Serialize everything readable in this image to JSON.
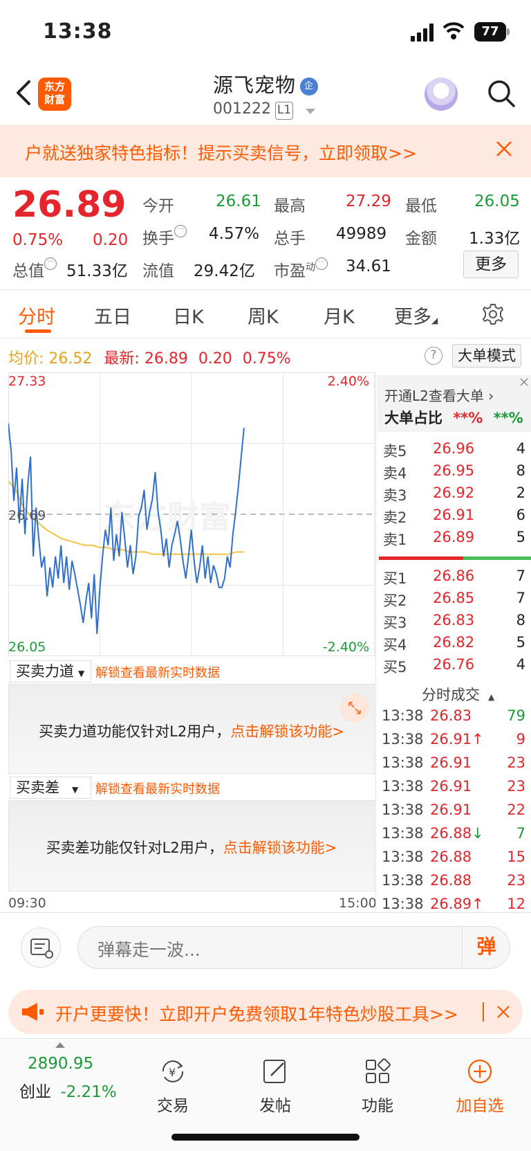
{
  "status": {
    "time": "13:38",
    "battery": "77"
  },
  "nav": {
    "logo_line1": "东方",
    "logo_line2": "财富",
    "title": "源飞宠物",
    "title_badge": "企",
    "code": "001222",
    "level": "L1"
  },
  "banner": {
    "text": "户就送独家特色指标！提示买卖信号，立即领取>>"
  },
  "quote": {
    "price": "26.89",
    "change_pct": "0.75%",
    "change": "0.20",
    "open_label": "今开",
    "open": "26.61",
    "high_label": "最高",
    "high": "27.29",
    "low_label": "最低",
    "low": "26.05",
    "turnover_label": "换手",
    "turnover": "4.57%",
    "volume_label": "总手",
    "volume": "49989",
    "amount_label": "金额",
    "amount": "1.33亿",
    "mktcap_label": "总值",
    "mktcap": "51.33亿",
    "float_label": "流值",
    "float": "29.42亿",
    "pe_label": "市盈",
    "pe_sup": "动",
    "pe": "34.61",
    "more": "更多"
  },
  "tabs": [
    "分时",
    "五日",
    "日K",
    "周K",
    "月K",
    "更多"
  ],
  "info": {
    "avg_label": "均价:",
    "avg": "26.52",
    "last_label": "最新:",
    "last": "26.89",
    "chg": "0.20",
    "pct": "0.75%",
    "mode": "大单模式"
  },
  "chart_data": {
    "type": "line",
    "y_left_top": "27.33",
    "y_left_mid": "26.69",
    "y_left_bottom": "26.05",
    "y_right_top": "2.40%",
    "y_right_bottom": "-2.40%",
    "x_start": "09:30",
    "x_end": "15:00",
    "watermark": "东方财富",
    "ylim": [
      26.05,
      27.33
    ],
    "prev_close": 26.69,
    "series": [
      {
        "values": [
          27.1,
          26.98,
          26.75,
          26.9,
          26.65,
          26.85,
          26.6,
          26.82,
          26.95,
          26.5,
          26.72,
          26.58,
          26.45,
          26.5,
          26.32,
          26.45,
          26.36,
          26.5,
          26.4,
          26.55,
          26.38,
          26.5,
          26.35,
          26.48,
          26.42,
          26.35,
          26.28,
          26.2,
          26.3,
          26.38,
          26.22,
          26.42,
          26.15,
          26.35,
          26.5,
          26.62,
          26.55,
          26.72,
          26.48,
          26.6,
          26.5,
          26.7,
          26.58,
          26.45,
          26.55,
          26.42,
          26.5,
          26.68,
          26.72,
          26.8,
          26.62,
          26.7,
          26.76,
          26.88,
          26.7,
          26.62,
          26.5,
          26.58,
          26.45,
          26.55,
          26.6,
          26.66,
          26.58,
          26.48,
          26.4,
          26.5,
          26.62,
          26.48,
          26.38,
          26.45,
          26.55,
          26.4,
          26.5,
          26.38,
          26.46,
          26.42,
          26.36,
          26.36,
          26.4,
          26.5,
          26.45,
          26.6,
          26.7,
          26.82,
          26.95,
          27.08
        ]
      },
      {
        "values": [
          26.84,
          26.8,
          26.72,
          26.68,
          26.65,
          26.62,
          26.6,
          26.58,
          26.57,
          26.56,
          26.55,
          26.55,
          26.54,
          26.54,
          26.53,
          26.53,
          26.52,
          26.52,
          26.52,
          26.51,
          26.51,
          26.51,
          26.51,
          26.51,
          26.51,
          26.51,
          26.51,
          26.51,
          26.51,
          26.51,
          26.52,
          26.52
        ]
      }
    ]
  },
  "ind1": {
    "name": "买卖力道",
    "note": "解锁查看最新实时数据",
    "msg": "买卖力道功能仅针对L2用户，",
    "link": "点击解锁该功能>"
  },
  "ind2": {
    "name": "买卖差",
    "note": "解锁查看最新实时数据",
    "msg": "买卖差功能仅针对L2用户，",
    "link": "点击解锁该功能>"
  },
  "l2": {
    "open_text": "开通L2查看大单",
    "ratio_label": "大单占比",
    "red_val": "**%",
    "green_val": "**%"
  },
  "asks": [
    {
      "label": "卖5",
      "price": "26.96",
      "vol": "4"
    },
    {
      "label": "卖4",
      "price": "26.95",
      "vol": "8"
    },
    {
      "label": "卖3",
      "price": "26.92",
      "vol": "2"
    },
    {
      "label": "卖2",
      "price": "26.91",
      "vol": "6"
    },
    {
      "label": "卖1",
      "price": "26.89",
      "vol": "5"
    }
  ],
  "bids": [
    {
      "label": "买1",
      "price": "26.86",
      "vol": "7"
    },
    {
      "label": "买2",
      "price": "26.85",
      "vol": "7"
    },
    {
      "label": "买3",
      "price": "26.83",
      "vol": "8"
    },
    {
      "label": "买4",
      "price": "26.82",
      "vol": "5"
    },
    {
      "label": "买5",
      "price": "26.76",
      "vol": "4"
    }
  ],
  "ticks_title": "分时成交",
  "ticks": [
    {
      "time": "13:38",
      "price": "26.83",
      "vol": "79",
      "arrow": "",
      "dir": "g"
    },
    {
      "time": "13:38",
      "price": "26.91",
      "vol": "9",
      "arrow": "↑",
      "dir": "r"
    },
    {
      "time": "13:38",
      "price": "26.91",
      "vol": "23",
      "arrow": "",
      "dir": "r"
    },
    {
      "time": "13:38",
      "price": "26.91",
      "vol": "23",
      "arrow": "",
      "dir": "r"
    },
    {
      "time": "13:38",
      "price": "26.91",
      "vol": "22",
      "arrow": "",
      "dir": "r"
    },
    {
      "time": "13:38",
      "price": "26.88",
      "vol": "7",
      "arrow": "↓",
      "dir": "g"
    },
    {
      "time": "13:38",
      "price": "26.88",
      "vol": "15",
      "arrow": "",
      "dir": "r"
    },
    {
      "time": "13:38",
      "price": "26.88",
      "vol": "23",
      "arrow": "",
      "dir": "r"
    },
    {
      "time": "13:38",
      "price": "26.89",
      "vol": "12",
      "arrow": "↑",
      "dir": "r"
    }
  ],
  "comment": {
    "placeholder": "弹幕走一波...",
    "send": "弹"
  },
  "promo2": {
    "text": "开户更要快！立即开户免费领取1年特色炒股工具>>"
  },
  "tabbar": {
    "index_value": "2890.95",
    "index_name": "创业",
    "index_pct": "-2.21%",
    "trade": "交易",
    "post": "发帖",
    "func": "功能",
    "add": "加自选"
  },
  "colors": {
    "accent": "#ff5a00",
    "up": "#e4252c",
    "down": "#1a9b35",
    "price_line": "#2e6fce",
    "avg_line": "#f5c242"
  }
}
